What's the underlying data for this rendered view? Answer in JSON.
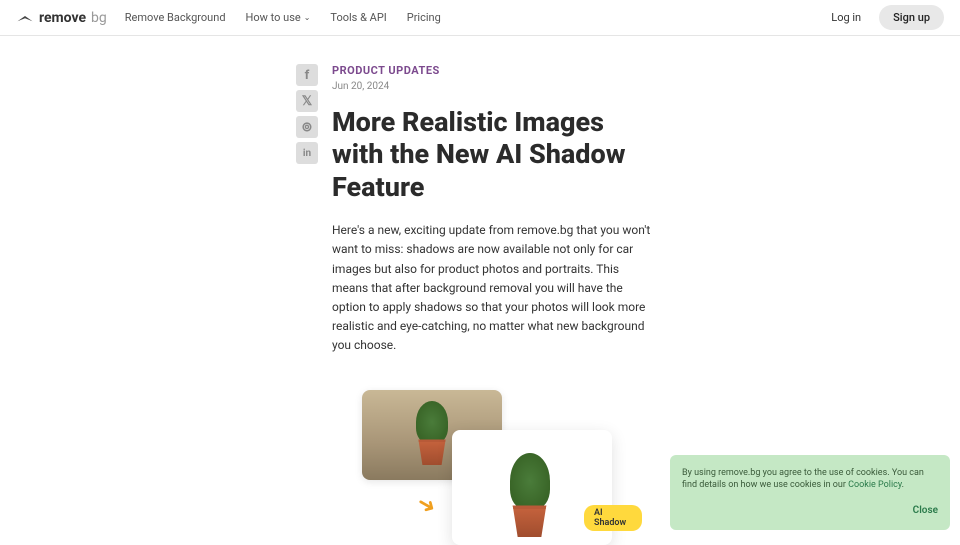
{
  "header": {
    "logo_main": "remove",
    "logo_suffix": "bg",
    "nav": {
      "remove_bg": "Remove Background",
      "how_to": "How to use",
      "tools": "Tools & API",
      "pricing": "Pricing"
    },
    "login": "Log in",
    "signup": "Sign up"
  },
  "article": {
    "category": "PRODUCT UPDATES",
    "date": "Jun 20, 2024",
    "title": "More Realistic Images with the New AI Shadow Feature",
    "body": "Here's a new, exciting update from remove.bg that you won't want to miss: shadows are now available not only for car images but also for product photos and portraits. This means that after background removal you will have the option to apply shadows so that your photos will look more realistic and eye-catching, no matter what new background you choose.",
    "badge": "AI Shadow"
  },
  "share": {
    "facebook": "f",
    "twitter": "𝕏",
    "reddit": "⊚",
    "linkedin": "in"
  },
  "cookie": {
    "text_before": "By using remove.bg you agree to the use of cookies. You can find details on how we use cookies in our ",
    "link": "Cookie Policy",
    "text_after": ".",
    "close": "Close"
  }
}
